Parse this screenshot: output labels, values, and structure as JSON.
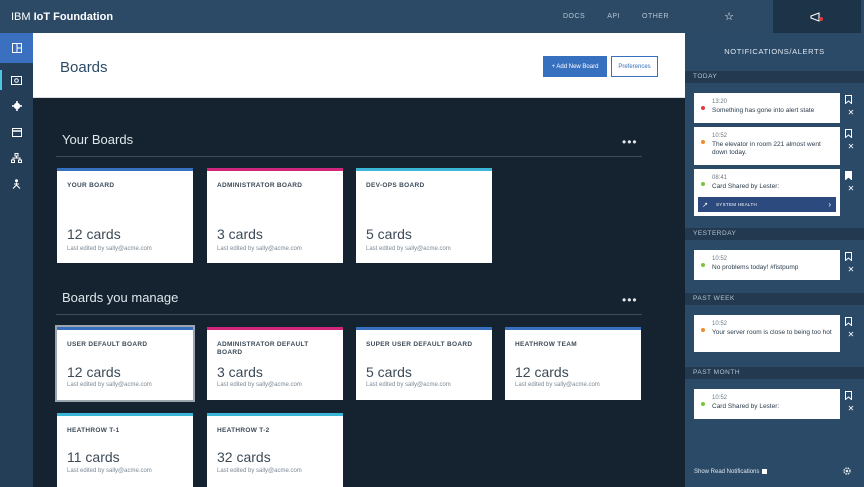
{
  "app": {
    "brand_light": "IBM ",
    "brand_bold": "IoT Foundation"
  },
  "topnav": [
    {
      "id": "docs",
      "label": "DOCS"
    },
    {
      "id": "api",
      "label": "API"
    },
    {
      "id": "other",
      "label": "OTHER"
    }
  ],
  "right_tabs": [
    {
      "id": "favorites",
      "icon": "star-icon",
      "glyph": "☆"
    },
    {
      "id": "alerts",
      "icon": "megaphone-icon",
      "glyph": "⟐"
    }
  ],
  "rail": [
    {
      "id": "boards",
      "icon": "dashboard-icon",
      "glyph": "▣"
    },
    {
      "id": "devices",
      "icon": "device-icon",
      "glyph": "◘"
    },
    {
      "id": "settings",
      "icon": "gear-icon",
      "glyph": "✱"
    },
    {
      "id": "storage",
      "icon": "storage-icon",
      "glyph": "▤"
    },
    {
      "id": "org",
      "icon": "org-chart-icon",
      "glyph": "⸙"
    },
    {
      "id": "users",
      "icon": "person-icon",
      "glyph": "⅄"
    }
  ],
  "header": {
    "title": "Boards",
    "add_button": "+ Add New Board",
    "preferences_button": "Preferences"
  },
  "your_boards": {
    "title": "Your Boards",
    "more": "•••",
    "cards": [
      {
        "name": "YOUR BOARD",
        "count": "12 cards",
        "edited": "Last edited by sally@acme.com",
        "accent": "#3870c0"
      },
      {
        "name": "ADMINISTRATOR BOARD",
        "count": "3 cards",
        "edited": "Last edited by sally@acme.com",
        "accent": "#d0267b"
      },
      {
        "name": "DEV-OPS BOARD",
        "count": "5 cards",
        "edited": "Last edited by sally@acme.com",
        "accent": "#3bb6d6"
      }
    ]
  },
  "managed_boards": {
    "title": "Boards you manage",
    "more": "•••",
    "cards": [
      {
        "name": "USER DEFAULT BOARD",
        "count": "12 cards",
        "edited": "Last edited by sally@acme.com",
        "accent": "#3870c0"
      },
      {
        "name": "ADMINISTRATOR DEFAULT BOARD",
        "count": "3 cards",
        "edited": "Last edited by sally@acme.com",
        "accent": "#d0267b"
      },
      {
        "name": "SUPER USER DEFAULT BOARD",
        "count": "5 cards",
        "edited": "Last edited by sally@acme.com",
        "accent": "#3870c0"
      },
      {
        "name": "HEATHROW TEAM",
        "count": "12 cards",
        "edited": "Last edited by sally@acme.com",
        "accent": "#3870c0"
      },
      {
        "name": "HEATHROW T-1",
        "count": "11 cards",
        "edited": "Last edited by sally@acme.com",
        "accent": "#3bb6d6"
      },
      {
        "name": "HEATHROW T-2",
        "count": "32 cards",
        "edited": "Last edited by sally@acme.com",
        "accent": "#3bb6d6"
      }
    ]
  },
  "notifications": {
    "title": "NOTIFICATIONS/ALERTS",
    "groups": [
      {
        "label": "TODAY",
        "items": [
          {
            "time": "13:20",
            "message": "Something has gone into alert state",
            "status_color": "#e23a3a",
            "bookmarked": false
          },
          {
            "time": "10:52",
            "message": "The elevator in room 221 almost went down today.",
            "status_color": "#f08a2a",
            "bookmarked": false
          },
          {
            "time": "08:41",
            "message": "Card Shared by Lester:",
            "status_color": "#7cc43a",
            "bookmarked": true,
            "chip": "SYSTEM HEALTH"
          }
        ]
      },
      {
        "label": "YESTERDAY",
        "items": [
          {
            "time": "10:52",
            "message": "No problems today! #fistpump",
            "status_color": "#7cc43a",
            "bookmarked": false
          }
        ]
      },
      {
        "label": "PAST WEEK",
        "items": [
          {
            "time": "10:52",
            "message": "Your server room is close to being too hot",
            "status_color": "#f08a2a",
            "bookmarked": false
          }
        ]
      },
      {
        "label": "PAST MONTH",
        "items": [
          {
            "time": "10:52",
            "message": "Card Shared by Lester:",
            "status_color": "#7cc43a",
            "bookmarked": false
          }
        ]
      }
    ],
    "show_read": "Show Read Notifications"
  }
}
